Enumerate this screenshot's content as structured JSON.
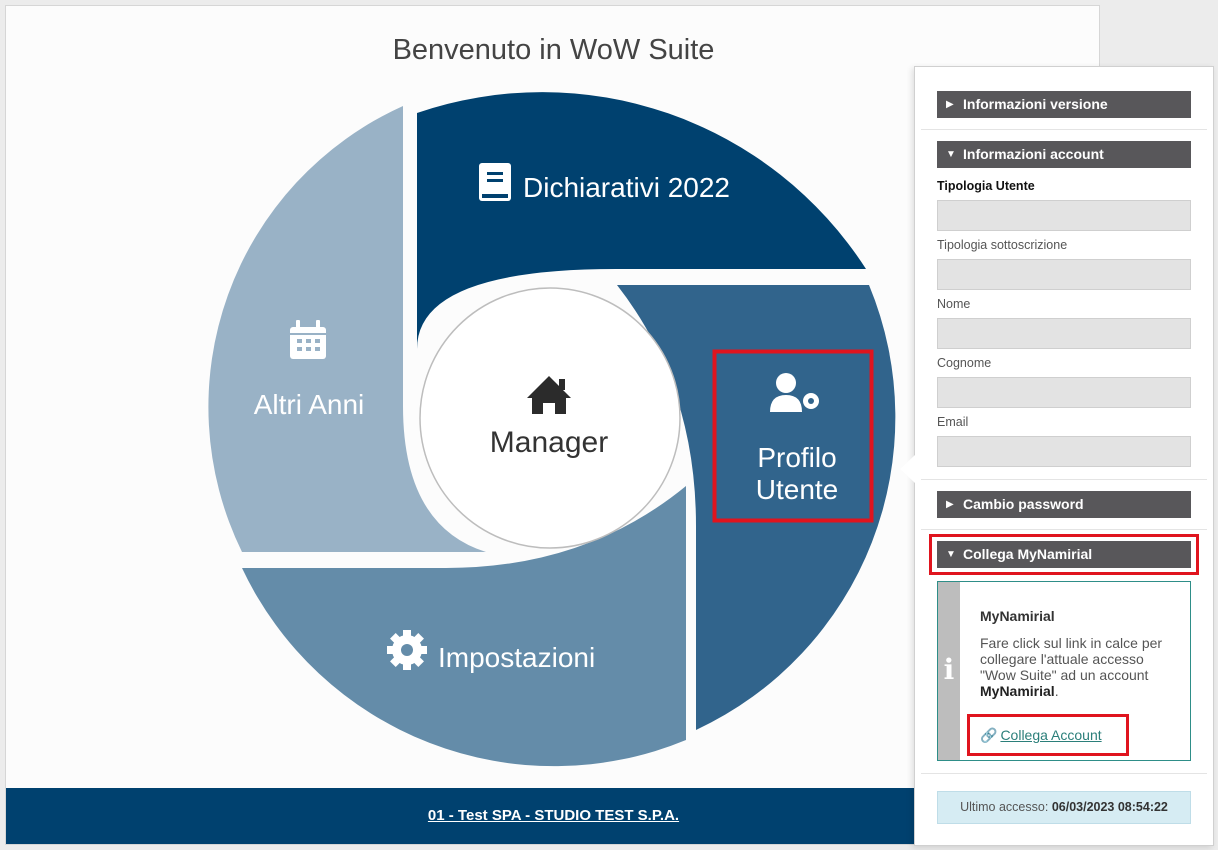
{
  "title": "Benvenuto in WoW Suite",
  "colors": {
    "dark_blue": "#00416f",
    "mid_blue": "#31648c",
    "steel_blue": "#648ca9",
    "light_blue": "#99b2c6",
    "accent_red": "#e0141e",
    "link_teal": "#2b7f7a"
  },
  "segments": {
    "dichiarativi": {
      "label": "Dichiarativi 2022",
      "icon": "book-icon"
    },
    "profilo": {
      "line1": "Profilo",
      "line2": "Utente",
      "icon": "user-gear-icon"
    },
    "impostazioni": {
      "label": "Impostazioni",
      "icon": "gear-icon"
    },
    "altri_anni": {
      "label": "Altri Anni",
      "icon": "calendar-icon"
    },
    "manager": {
      "label": "Manager",
      "icon": "home-icon"
    }
  },
  "footer": {
    "text": "01 - Test SPA - STUDIO TEST S.P.A."
  },
  "panel": {
    "info_versione": "Informazioni versione",
    "info_account": "Informazioni account",
    "fields": {
      "tipologia_utente": "Tipologia Utente",
      "tipologia_sottoscrizione": "Tipologia sottoscrizione",
      "nome": "Nome",
      "cognome": "Cognome",
      "email": "Email"
    },
    "cambio_password": "Cambio password",
    "collega_mynamirial": "Collega MyNamirial",
    "info": {
      "title": "MyNamirial",
      "text_before": "Fare click sul link in calce per collegare l'attuale accesso \"Wow Suite\" ad un account ",
      "text_bold": "MyNamirial",
      "text_after": ".",
      "link": "Collega Account"
    },
    "last_access": {
      "label": "Ultimo accesso:",
      "value": "06/03/2023 08:54:22"
    }
  }
}
